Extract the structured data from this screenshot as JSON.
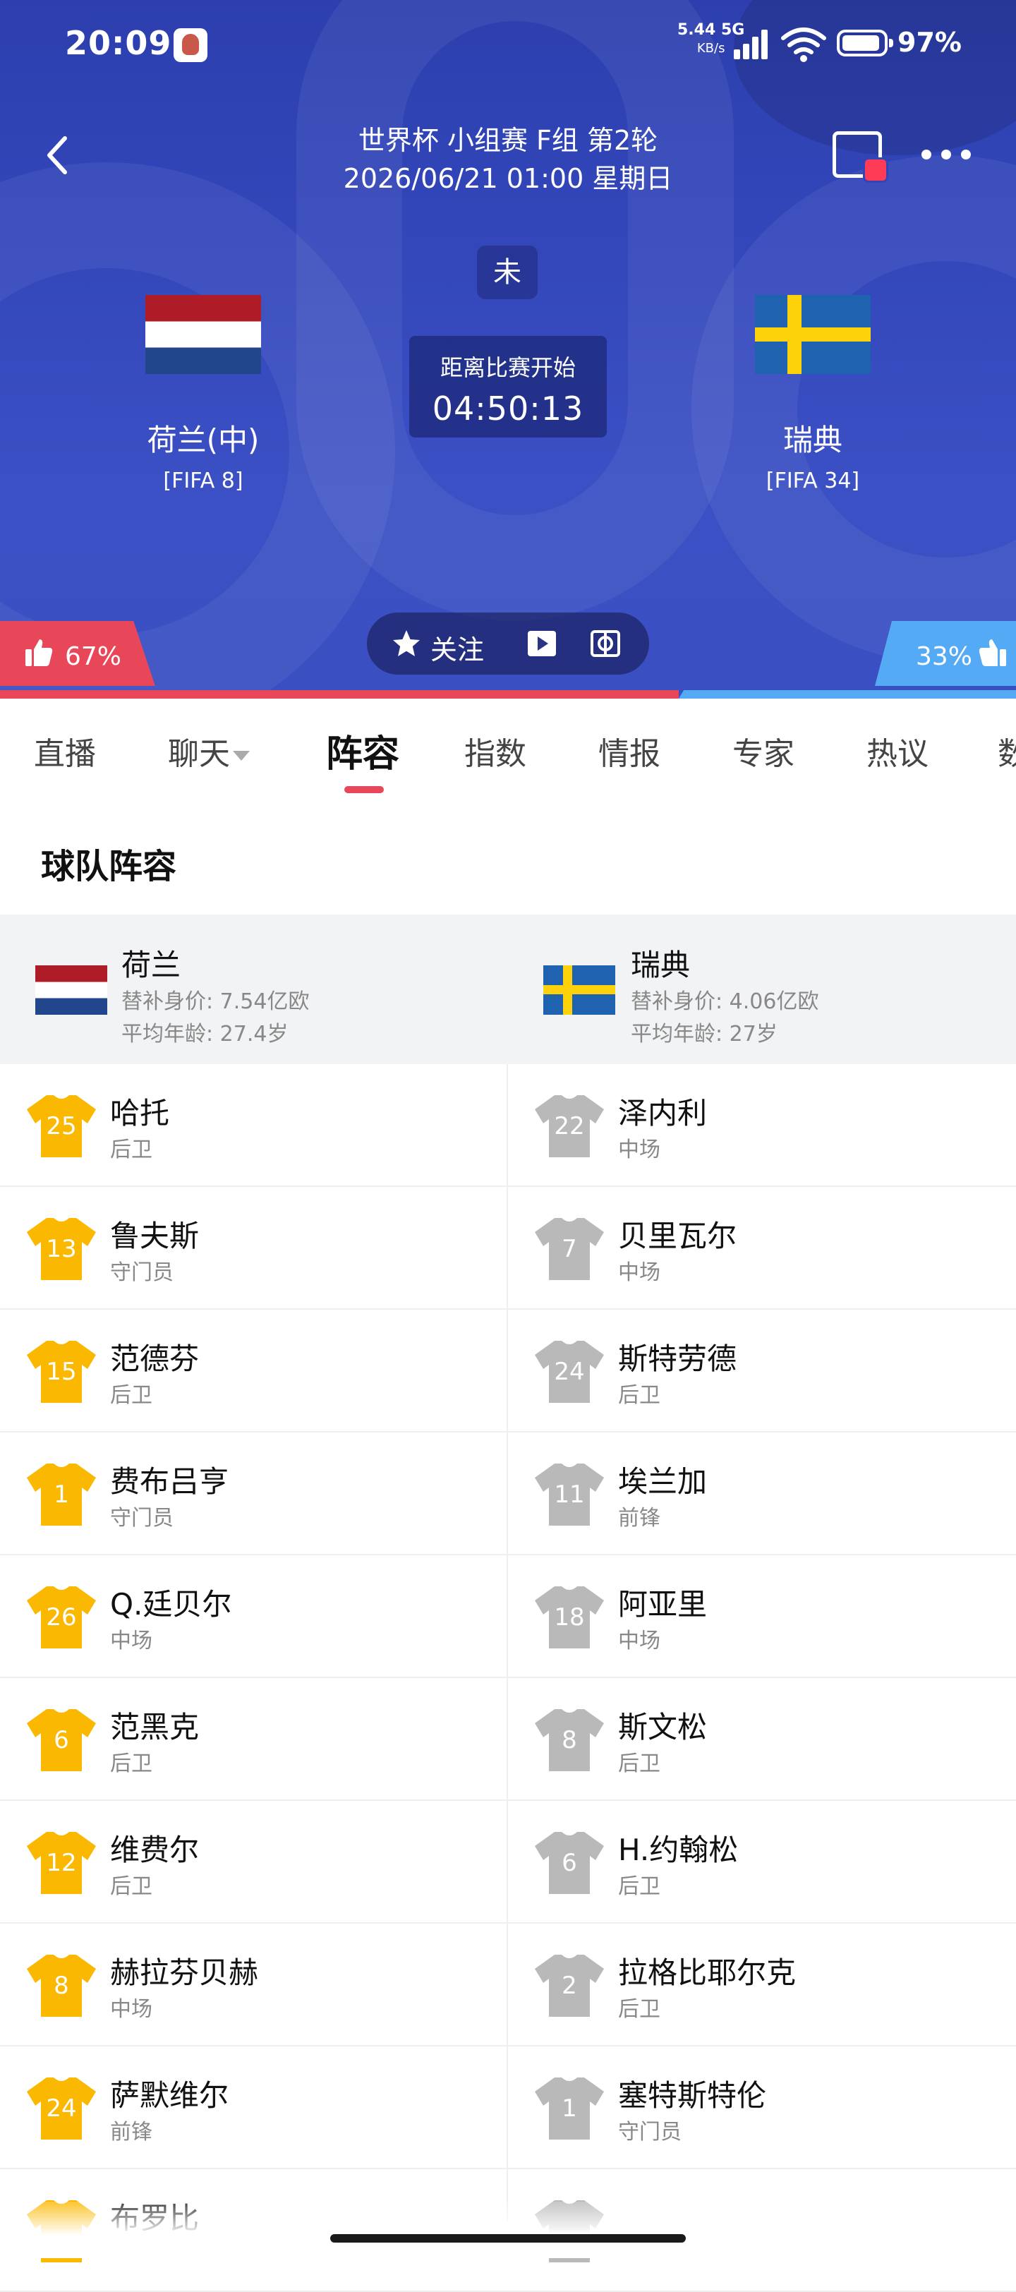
{
  "status_bar": {
    "time": "20:09",
    "net_speed": "5.44",
    "net_unit": "KB/s",
    "net_type": "5G",
    "battery": "97%"
  },
  "match": {
    "title": "世界杯 小组赛 F组 第2轮",
    "datetime": "2026/06/21 01:00 星期日",
    "status": "未",
    "countdown_label": "距离比赛开始",
    "countdown": "04:50:13",
    "home": {
      "name": "荷兰(中)",
      "rank": "[FIFA 8]"
    },
    "away": {
      "name": "瑞典",
      "rank": "[FIFA 34]"
    },
    "vote_home": "67%",
    "vote_away": "33%",
    "vote_home_fraction": 0.67,
    "follow_label": "关注"
  },
  "colors": {
    "hero_blue": "#3347bb",
    "accent_red": "#e8475a",
    "accent_blue": "#55aaf5",
    "home_shirt": "#fbb800",
    "away_shirt": "#b9b9b9"
  },
  "tabs": [
    "直播",
    "聊天",
    "阵容",
    "指数",
    "情报",
    "专家",
    "热议",
    "数"
  ],
  "active_tab": "阵容",
  "section_title": "球队阵容",
  "lineup": {
    "home": {
      "name": "荷兰",
      "sub_value": "替补身价: 7.54亿欧",
      "avg_age": "平均年龄: 27.4岁"
    },
    "away": {
      "name": "瑞典",
      "sub_value": "替补身价: 4.06亿欧",
      "avg_age": "平均年龄: 27岁"
    },
    "rows": [
      {
        "home": {
          "num": "25",
          "name": "哈托",
          "pos": "后卫"
        },
        "away": {
          "num": "22",
          "name": "泽内利",
          "pos": "中场"
        }
      },
      {
        "home": {
          "num": "13",
          "name": "鲁夫斯",
          "pos": "守门员"
        },
        "away": {
          "num": "7",
          "name": "贝里瓦尔",
          "pos": "中场"
        }
      },
      {
        "home": {
          "num": "15",
          "name": "范德芬",
          "pos": "后卫"
        },
        "away": {
          "num": "24",
          "name": "斯特劳德",
          "pos": "后卫"
        }
      },
      {
        "home": {
          "num": "1",
          "name": "费布吕亨",
          "pos": "守门员"
        },
        "away": {
          "num": "11",
          "name": "埃兰加",
          "pos": "前锋"
        }
      },
      {
        "home": {
          "num": "26",
          "name": "Q.廷贝尔",
          "pos": "中场"
        },
        "away": {
          "num": "18",
          "name": "阿亚里",
          "pos": "中场"
        }
      },
      {
        "home": {
          "num": "6",
          "name": "范黑克",
          "pos": "后卫"
        },
        "away": {
          "num": "8",
          "name": "斯文松",
          "pos": "后卫"
        }
      },
      {
        "home": {
          "num": "12",
          "name": "维费尔",
          "pos": "后卫"
        },
        "away": {
          "num": "6",
          "name": "H.约翰松",
          "pos": "后卫"
        }
      },
      {
        "home": {
          "num": "8",
          "name": "赫拉芬贝赫",
          "pos": "中场"
        },
        "away": {
          "num": "2",
          "name": "拉格比耶尔克",
          "pos": "后卫"
        }
      },
      {
        "home": {
          "num": "24",
          "name": "萨默维尔",
          "pos": "前锋"
        },
        "away": {
          "num": "1",
          "name": "塞特斯特伦",
          "pos": "守门员"
        }
      },
      {
        "home": {
          "num": "",
          "name": "布罗比",
          "pos": ""
        },
        "away": {
          "num": "",
          "name": "",
          "pos": ""
        }
      }
    ]
  }
}
